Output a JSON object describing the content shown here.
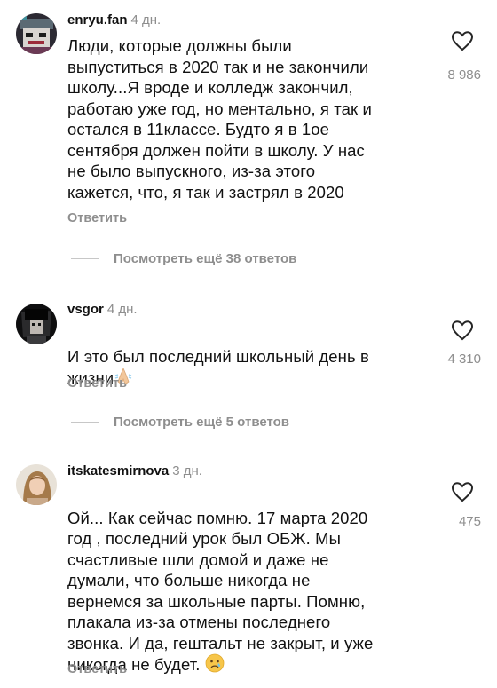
{
  "comments": [
    {
      "username": "enryu.fan",
      "time": "4 дн.",
      "text": "Люди, которые должны были\nвыпуститься в 2020 так и не закончили\nшколу...Я вроде и колледж закончил,\nработаю уже год, но ментально, я так и\nостался в 11классе. Будто я в 1ое\nсентября должен пойти в школу. У нас\nне было выпускного, из-за этого\nкажется, что, я так и застрял в 2020",
      "likes": "8 986",
      "reply_label": "Ответить",
      "view_replies": "Посмотреть ещё 38 ответов",
      "avatar_icon": "manga-character-avatar"
    },
    {
      "username": "vsgor",
      "time": "4 дн.",
      "text": "И это был последний школьный день в\nжизни",
      "emoji_icon": "folded-hands-emoji",
      "likes": "4 310",
      "reply_label": "Ответить",
      "view_replies": "Посмотреть ещё 5 ответов",
      "avatar_icon": "dark-anime-avatar"
    },
    {
      "username": "itskatesmirnova",
      "time": "3 дн.",
      "text": "Ой... Как сейчас помню. 17 марта 2020\nгод , последний урок был ОБЖ. Мы\nсчастливые шли домой и даже не\nдумали, что больше никогда не\nвернемся за школьные парты. Помню,\nплакала из-за отмены последнего\nзвонка. И да, гештальт не закрыт, и уже\nникогда не будет.",
      "emoji_icon": "crying-face-emoji",
      "likes": "475",
      "reply_label": "Ответить",
      "avatar_icon": "girl-photo-avatar"
    }
  ],
  "colors": {
    "text": "#111111",
    "secondary": "#8e8e8e",
    "divider": "#c7c7c7",
    "background": "#ffffff"
  }
}
